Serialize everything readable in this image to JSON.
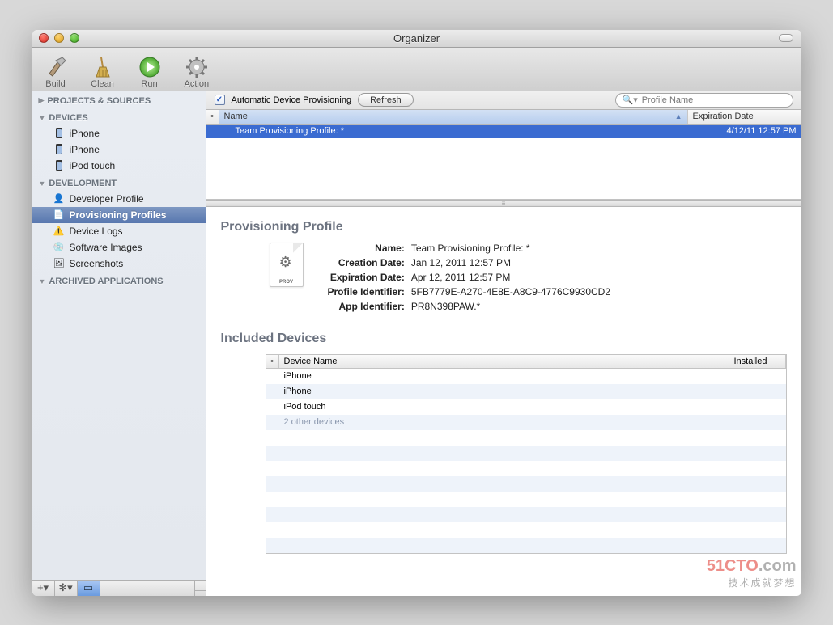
{
  "window": {
    "title": "Organizer"
  },
  "toolbar": {
    "build": "Build",
    "clean": "Clean",
    "run": "Run",
    "action": "Action"
  },
  "sidebar": {
    "groups": {
      "projects": "PROJECTS & SOURCES",
      "devices": "DEVICES",
      "development": "DEVELOPMENT",
      "archived": "ARCHIVED APPLICATIONS"
    },
    "devices": [
      "iPhone",
      "iPhone",
      "iPod touch"
    ],
    "dev": {
      "developer_profile": "Developer Profile",
      "provisioning_profiles": "Provisioning Profiles",
      "device_logs": "Device Logs",
      "software_images": "Software Images",
      "screenshots": "Screenshots"
    }
  },
  "topbar": {
    "auto_label": "Automatic Device Provisioning",
    "refresh": "Refresh",
    "search_placeholder": "Profile Name"
  },
  "profile_table": {
    "col_name": "Name",
    "col_exp": "Expiration Date",
    "row": {
      "name": "Team Provisioning Profile: *",
      "exp": "4/12/11 12:57 PM"
    }
  },
  "detail": {
    "heading": "Provisioning Profile",
    "prov_badge": "PROV",
    "fields": {
      "name_lbl": "Name:",
      "name_val": "Team Provisioning Profile: *",
      "creation_lbl": "Creation Date:",
      "creation_val": "Jan 12, 2011 12:57 PM",
      "exp_lbl": "Expiration Date:",
      "exp_val": "Apr 12, 2011 12:57 PM",
      "pid_lbl": "Profile Identifier:",
      "pid_val": "5FB7779E-A270-4E8E-A8C9-4776C9930CD2",
      "aid_lbl": "App Identifier:",
      "aid_val": "PR8N398PAW.*"
    }
  },
  "devices_section": {
    "heading": "Included Devices",
    "col_name": "Device Name",
    "col_inst": "Installed",
    "rows": [
      "iPhone",
      "iPhone",
      "iPod touch"
    ],
    "more": "2 other devices"
  },
  "watermark": {
    "brand1": "51CTO",
    "brand2": ".com",
    "tagline": "技术成就梦想"
  }
}
